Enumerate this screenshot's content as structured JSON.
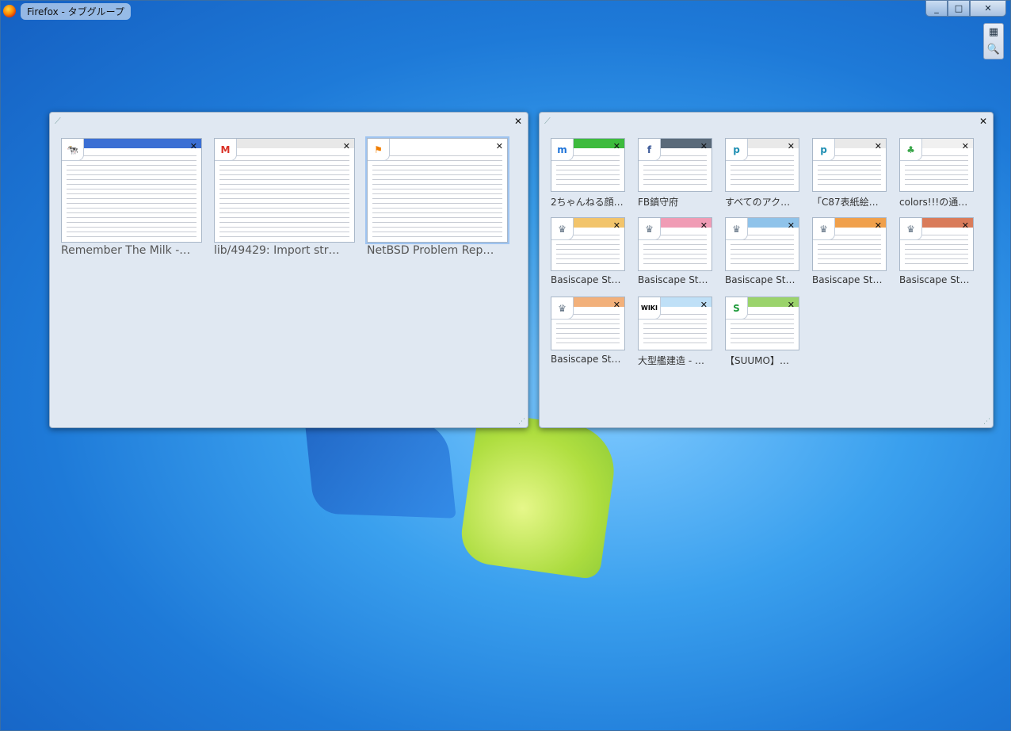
{
  "window": {
    "title": "Firefox - タブグループ",
    "controls": [
      "_",
      "□",
      "✕"
    ]
  },
  "side_tools": [
    "▦",
    "🔍"
  ],
  "groups": [
    {
      "name": "group-left",
      "tabs": [
        {
          "title": "Remember The Milk -…",
          "favicon": "🐄",
          "header_color": "#3b6fd4"
        },
        {
          "title": "lib/49429: Import str…",
          "favicon": "M",
          "favicon_color": "#d93025",
          "header_color": "#e8e8e8"
        },
        {
          "title": "NetBSD Problem Rep…",
          "favicon": "⚑",
          "favicon_color": "#f07d00",
          "header_color": "#ffffff",
          "active": true
        }
      ]
    },
    {
      "name": "group-right",
      "tabs": [
        {
          "title": "2ちゃんねる顔…",
          "favicon": "m",
          "favicon_color": "#1e73d8",
          "header_color": "#3dbb3d"
        },
        {
          "title": "FB鎮守府",
          "favicon": "f",
          "favicon_color": "#3b5998",
          "header_color": "#5a6a7a"
        },
        {
          "title": "すべてのアク…",
          "favicon": "p",
          "favicon_color": "#1f8fb3",
          "header_color": "#e9e9e9"
        },
        {
          "title": "「C87表紙絵…",
          "favicon": "p",
          "favicon_color": "#1f8fb3",
          "header_color": "#e9e9e9"
        },
        {
          "title": "colors!!!の通…",
          "favicon": "♣",
          "favicon_color": "#3aa64a",
          "header_color": "#f0f0f0"
        },
        {
          "title": "Basiscape St…",
          "favicon": "♛",
          "favicon_color": "#6a7a8a",
          "header_color": "#f2c46b"
        },
        {
          "title": "Basiscape St…",
          "favicon": "♛",
          "favicon_color": "#6a7a8a",
          "header_color": "#f09cb5"
        },
        {
          "title": "Basiscape St…",
          "favicon": "♛",
          "favicon_color": "#6a7a8a",
          "header_color": "#8fc3ea"
        },
        {
          "title": "Basiscape St…",
          "favicon": "♛",
          "favicon_color": "#6a7a8a",
          "header_color": "#f0a04b"
        },
        {
          "title": "Basiscape St…",
          "favicon": "♛",
          "favicon_color": "#6a7a8a",
          "header_color": "#d97b5a"
        },
        {
          "title": "Basiscape St…",
          "favicon": "♛",
          "favicon_color": "#6a7a8a",
          "header_color": "#f2b07a"
        },
        {
          "title": "大型艦建造 - …",
          "favicon": "WIKI",
          "favicon_color": "#000000",
          "header_color": "#bfe0f7"
        },
        {
          "title": "【SUUMO】…",
          "favicon": "S",
          "favicon_color": "#1e9a3a",
          "header_color": "#9bd36b"
        }
      ]
    }
  ]
}
